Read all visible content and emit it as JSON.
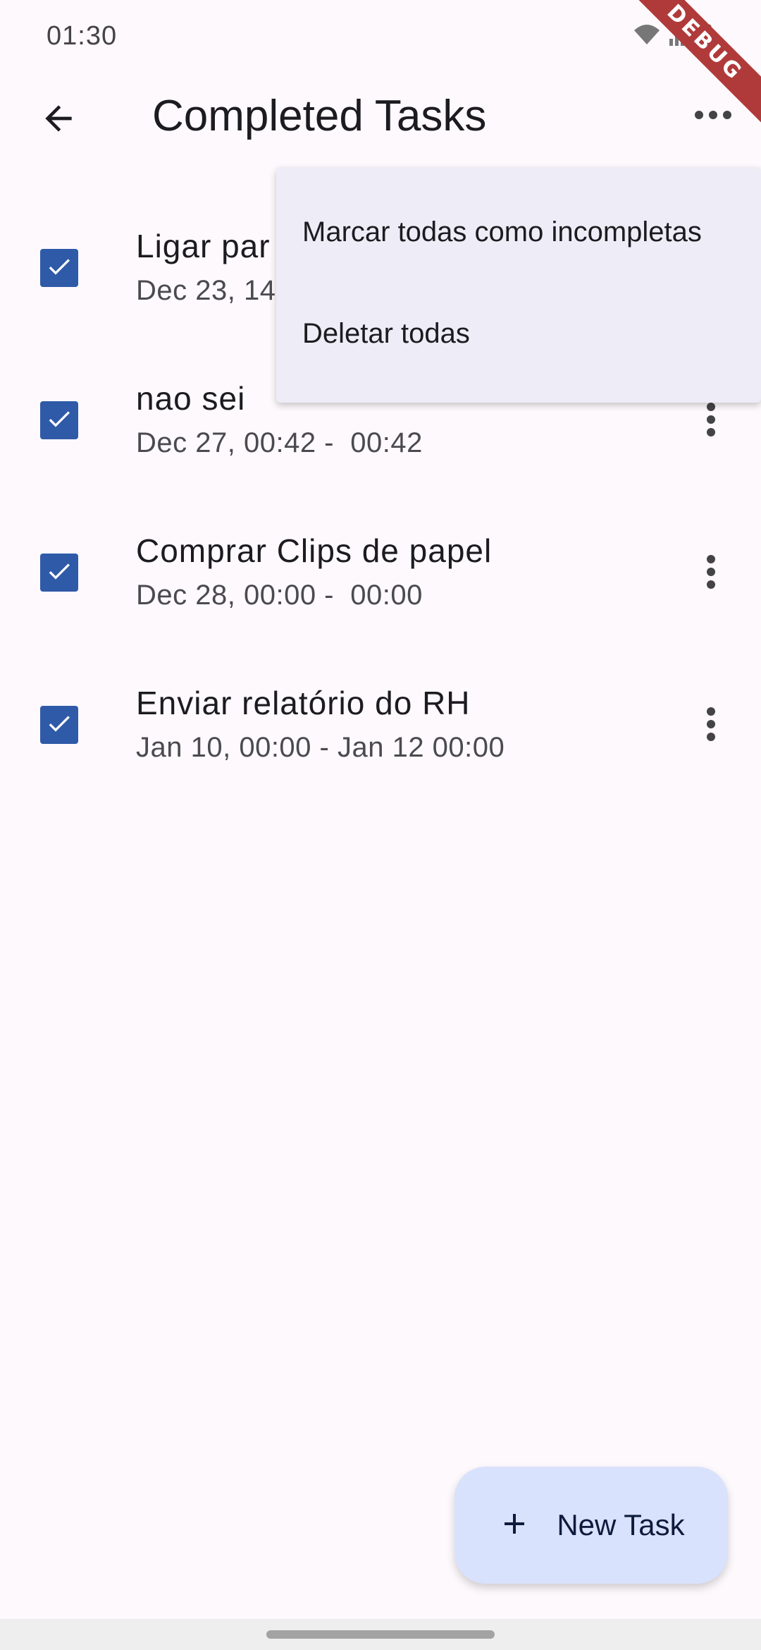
{
  "status_bar": {
    "time": "01:30",
    "icons": [
      "wifi-icon",
      "signal-icon",
      "battery-icon"
    ],
    "debug_label": "DEBUG"
  },
  "app_bar": {
    "title": "Completed Tasks",
    "back_icon": "arrow-back-icon",
    "overflow_icon": "more-horiz-icon"
  },
  "tasks": [
    {
      "title": "Ligar par",
      "subtitle": "Dec 23, 14",
      "completed": true
    },
    {
      "title": "nao sei",
      "subtitle": "Dec 27, 00:42 -  00:42",
      "completed": true
    },
    {
      "title": "Comprar Clips de papel",
      "subtitle": "Dec 28, 00:00 -  00:00",
      "completed": true
    },
    {
      "title": "Enviar relatório do RH",
      "subtitle": "Jan 10, 00:00 - Jan 12 00:00",
      "completed": true
    }
  ],
  "menu": {
    "items": [
      {
        "label": "Marcar todas como incompletas"
      },
      {
        "label": "Deletar todas"
      }
    ]
  },
  "fab": {
    "label": "New Task",
    "icon": "plus-icon"
  },
  "colors": {
    "background": "#fdf9fd",
    "checkbox": "#2f5aa8",
    "menu_bg": "#eeecf6",
    "fab_bg": "#d9e2fc",
    "debug_ribbon": "#b03a3a"
  }
}
